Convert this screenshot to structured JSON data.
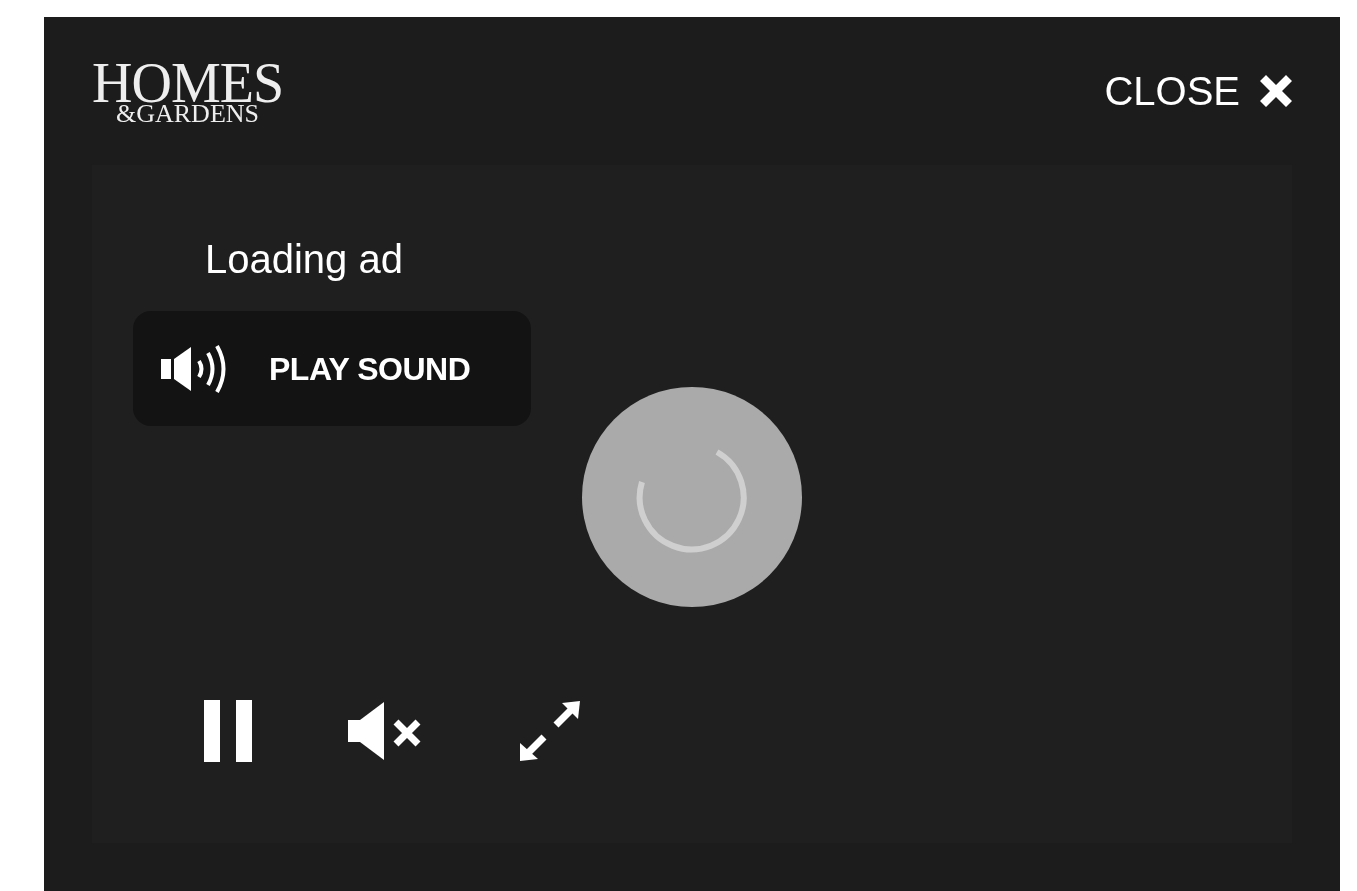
{
  "logo": {
    "line_1": "HOMES",
    "line_2": "&GARDENS"
  },
  "close": {
    "label": "CLOSE"
  },
  "player": {
    "status": "Loading ad",
    "play_sound_button": {
      "label": "PLAY SOUND"
    },
    "controls": [
      {
        "kind": "pause"
      },
      {
        "kind": "mute"
      },
      {
        "kind": "fullscreen"
      }
    ]
  }
}
